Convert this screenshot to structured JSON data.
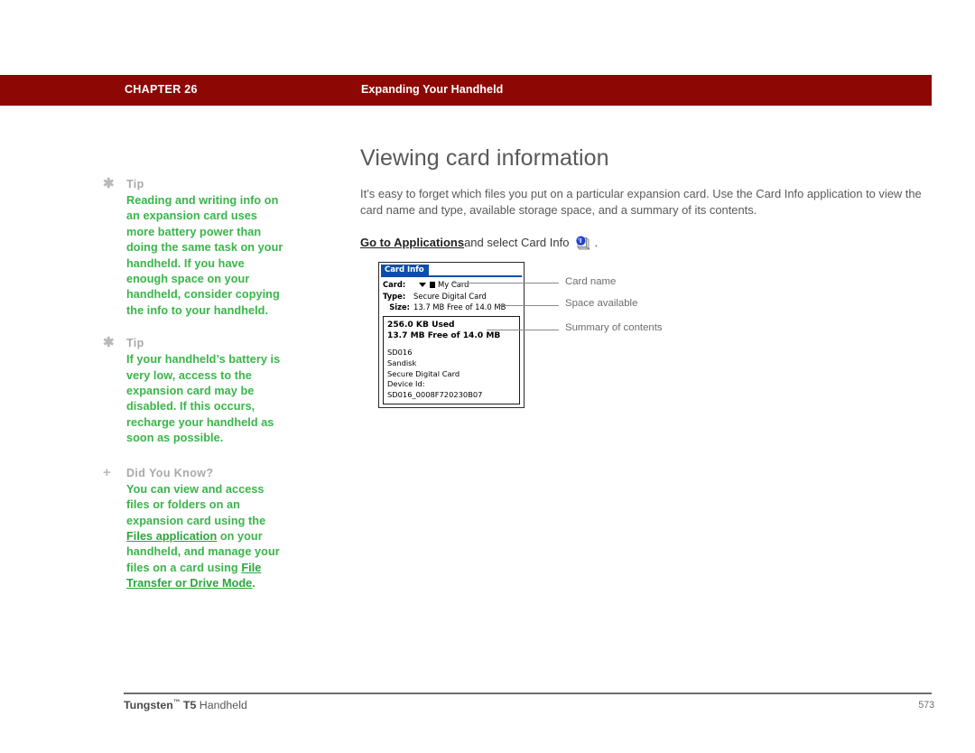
{
  "header": {
    "chapter": "CHAPTER 26",
    "title": "Expanding Your Handheld",
    "bar_color": "#8d0805"
  },
  "sidebar": {
    "blocks": [
      {
        "mark": "✱",
        "mark_name": "asterisk-icon",
        "label": "Tip",
        "text": "Reading and writing info on an expansion card uses more battery power than doing the same task on your handheld. If you have enough space on your handheld, consider copying the info to your handheld."
      },
      {
        "mark": "✱",
        "mark_name": "asterisk-icon",
        "label": "Tip",
        "text": "If your handheld’s battery is very low, access to the expansion card may be disabled. If this occurs, recharge your handheld as soon as possible."
      },
      {
        "mark": "+",
        "mark_name": "plus-icon",
        "label": "Did You Know?",
        "text_part1": "You can view and access files or folders on an expansion card using the ",
        "link1": "Files application",
        "text_part2": " on your handheld, and manage your files on a card using ",
        "link2": "File Transfer or Drive Mode",
        "text_part3": "."
      }
    ],
    "text_color": "#3ab54a",
    "label_color": "#a9a9a9"
  },
  "main": {
    "heading": "Viewing card information",
    "paragraph": "It’s easy to forget which files you put on a particular expansion card. Use the Card Info application to view the card name and type, available storage space, and a summary of its contents.",
    "instruction": {
      "link": "Go to Applications",
      "middle": " and select Card Info ",
      "end": ".",
      "icon_name": "card-info-icon"
    }
  },
  "device_screenshot": {
    "tab_label": "Card Info",
    "tab_color": "#0b4fa8",
    "rows": [
      {
        "label": "Card:",
        "value": "My Card",
        "has_dropdown": true
      },
      {
        "label": "Type:",
        "value": "Secure Digital Card",
        "has_dropdown": false
      },
      {
        "label": "Size:",
        "value": "13.7 MB Free of 14.0 MB",
        "has_dropdown": false
      }
    ],
    "panel": {
      "used": "256.0 KB Used",
      "free": "13.7 MB Free of 14.0 MB",
      "details": [
        "SD016",
        "Sandisk",
        "Secure Digital Card",
        "Device Id: SD016_0008F720230B07"
      ]
    }
  },
  "callouts": [
    {
      "label": "Card name"
    },
    {
      "label": "Space available"
    },
    {
      "label": "Summary of contents"
    }
  ],
  "footer": {
    "product": "Tungsten",
    "tm": "™",
    "model": " T5",
    "suffix": " Handheld",
    "page_number": "573"
  }
}
